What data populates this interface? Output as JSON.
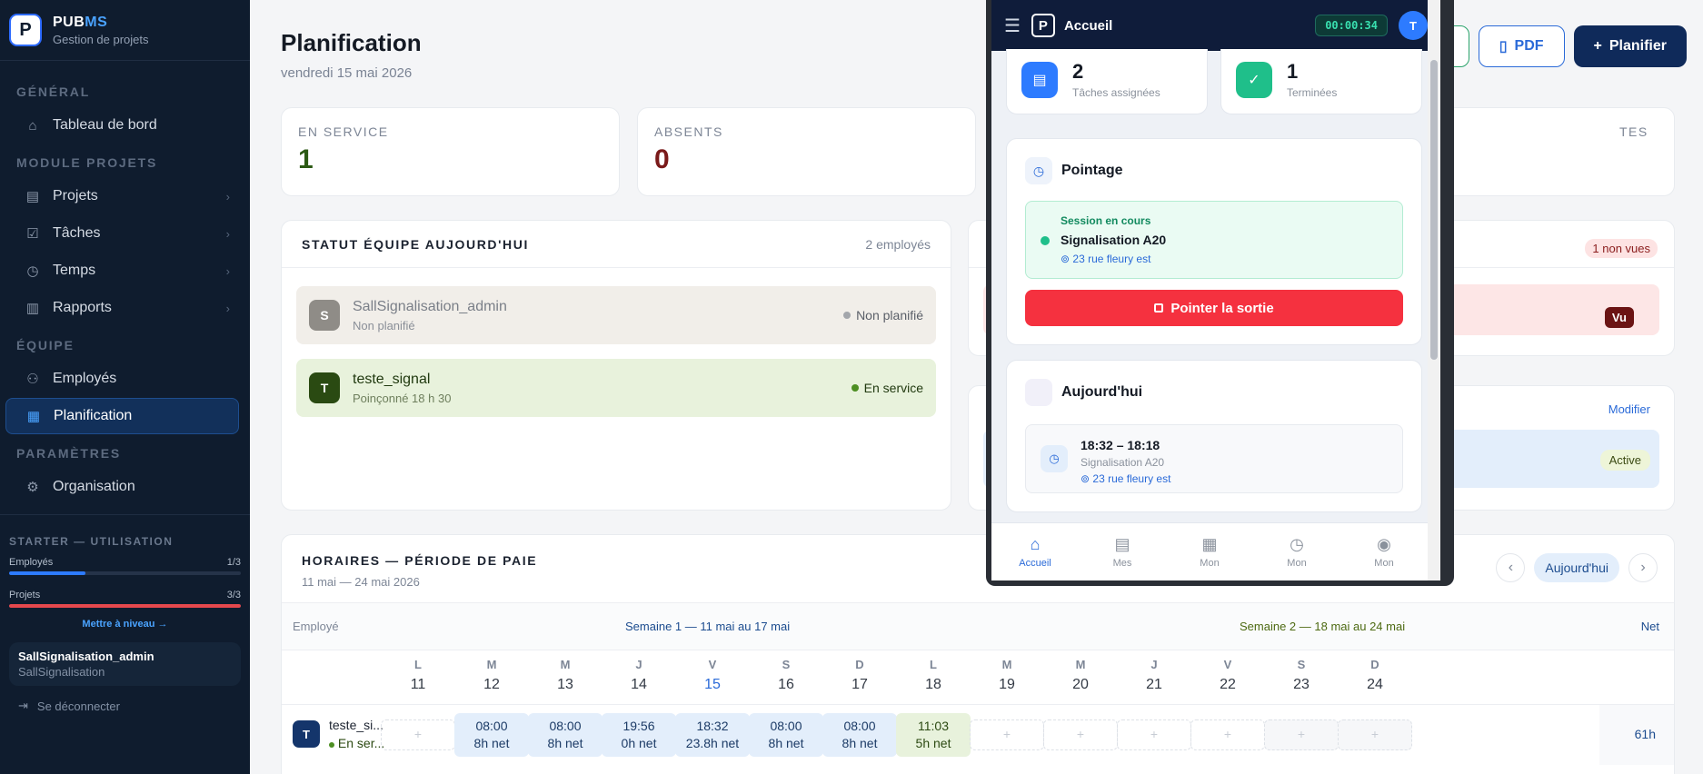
{
  "brand": {
    "name_a": "PUB",
    "name_b": "MS",
    "subtitle": "Gestion de projets",
    "logo_letter": "P"
  },
  "sidebar": {
    "sections": {
      "general": "GÉNÉRAL",
      "projects": "MODULE PROJETS",
      "team": "ÉQUIPE",
      "settings": "PARAMÈTRES"
    },
    "items": {
      "dashboard": "Tableau de bord",
      "projects": "Projets",
      "tasks": "Tâches",
      "time": "Temps",
      "reports": "Rapports",
      "employees": "Employés",
      "planning": "Planification",
      "organisation": "Organisation"
    },
    "usage": {
      "title": "STARTER — UTILISATION",
      "employees_label": "Employés",
      "employees_value": "1/3",
      "employees_fraction": 0.33,
      "projects_label": "Projets",
      "projects_value": "3/3",
      "projects_fraction": 1.0,
      "upgrade": "Mettre à niveau →"
    },
    "user": {
      "name": "SallSignalisation_admin",
      "org": "SallSignalisation"
    },
    "logout": "Se déconnecter"
  },
  "header": {
    "title": "Planification",
    "date": "vendredi 15 mai 2026",
    "pdf_label": "PDF",
    "plan_label": "Planifier"
  },
  "stats": {
    "in_service_label": "EN SERVICE",
    "in_service_value": "1",
    "absent_label": "ABSENTS",
    "absent_value": "0",
    "hidden_label": "TES"
  },
  "team": {
    "title": "STATUT ÉQUIPE AUJOURD'HUI",
    "count": "2 employés",
    "rows": [
      {
        "initial": "S",
        "name": "SallSignalisation_admin",
        "sub": "Non planifié",
        "status": "Non planifié"
      },
      {
        "initial": "T",
        "name": "teste_signal",
        "sub": "Poinçonné 18 h 30",
        "status": "En service"
      }
    ]
  },
  "right_panel": {
    "unseen": "1 non vues",
    "seen": "Vu",
    "modify": "Modifier",
    "active": "Active"
  },
  "schedule": {
    "title": "HORAIRES — PÉRIODE DE PAIE",
    "range": "11 mai — 24 mai 2026",
    "today_label": "Aujourd'hui",
    "col_employee": "Employé",
    "week1": "Semaine 1 — 11 mai au 17 mai",
    "week2": "Semaine 2 — 18 mai au 24 mai",
    "col_net": "Net",
    "days": [
      {
        "l": "L",
        "n": "11"
      },
      {
        "l": "M",
        "n": "12"
      },
      {
        "l": "M",
        "n": "13"
      },
      {
        "l": "J",
        "n": "14"
      },
      {
        "l": "V",
        "n": "15"
      },
      {
        "l": "S",
        "n": "16"
      },
      {
        "l": "D",
        "n": "17"
      },
      {
        "l": "L",
        "n": "18"
      },
      {
        "l": "M",
        "n": "19"
      },
      {
        "l": "M",
        "n": "20"
      },
      {
        "l": "J",
        "n": "21"
      },
      {
        "l": "V",
        "n": "22"
      },
      {
        "l": "S",
        "n": "23"
      },
      {
        "l": "D",
        "n": "24"
      }
    ],
    "employee": {
      "initial": "T",
      "name": "teste_si...",
      "status": "En ser...",
      "net_total": "61h"
    },
    "shifts": [
      {
        "t": "",
        "n": ""
      },
      {
        "t": "08:00",
        "n": "8h net"
      },
      {
        "t": "08:00",
        "n": "8h net"
      },
      {
        "t": "19:56",
        "n": "0h net"
      },
      {
        "t": "18:32",
        "n": "23.8h net"
      },
      {
        "t": "08:00",
        "n": "8h net"
      },
      {
        "t": "08:00",
        "n": "8h net"
      },
      {
        "t": "11:03",
        "n": "5h net"
      },
      {
        "t": "",
        "n": ""
      },
      {
        "t": "",
        "n": ""
      },
      {
        "t": "",
        "n": ""
      },
      {
        "t": "",
        "n": ""
      },
      {
        "t": "",
        "n": ""
      },
      {
        "t": "",
        "n": ""
      }
    ],
    "add_symbol": "+"
  },
  "mobile": {
    "title": "Accueil",
    "timer": "00:00:34",
    "avatar": "T",
    "logo_letter": "P",
    "assigned_value": "2",
    "assigned_label": "Tâches assignées",
    "done_value": "1",
    "done_label": "Terminées",
    "pointage_title": "Pointage",
    "session_label": "Session en cours",
    "session_project": "Signalisation A20",
    "session_address": "⊚ 23 rue fleury est",
    "clock_out": "Pointer la sortie",
    "today_title": "Aujourd'hui",
    "today_time": "18:32 – 18:18",
    "today_project": "Signalisation A20",
    "today_address": "⊚ 23 rue fleury est",
    "nav": [
      "Accueil",
      "Mes",
      "Mon",
      "Mon",
      "Mon"
    ]
  }
}
